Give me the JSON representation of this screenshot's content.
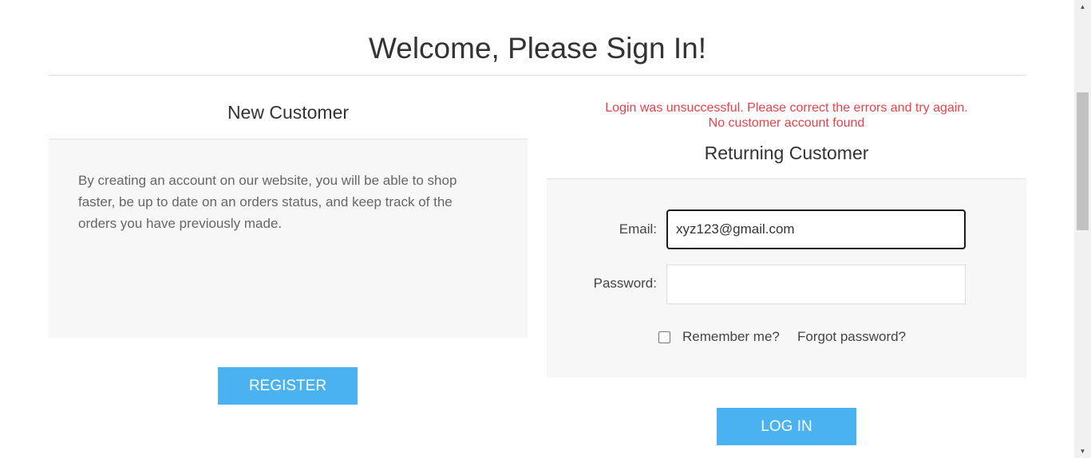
{
  "page": {
    "title": "Welcome, Please Sign In!"
  },
  "new_customer": {
    "heading": "New Customer",
    "description": "By creating an account on our website, you will be able to shop faster, be up to date on an orders status, and keep track of the orders you have previously made.",
    "register_label": "REGISTER"
  },
  "returning_customer": {
    "error_line1": "Login was unsuccessful. Please correct the errors and try again.",
    "error_line2": "No customer account found",
    "heading": "Returning Customer",
    "email_label": "Email:",
    "email_value": "xyz123@gmail.com",
    "password_label": "Password:",
    "password_value": "",
    "remember_label": "Remember me?",
    "remember_checked": false,
    "forgot_label": "Forgot password?",
    "login_label": "LOG IN"
  },
  "scrollbar": {
    "up_icon": "chevron-up-icon",
    "down_icon": "chevron-down-icon"
  },
  "colors": {
    "button": "#4ab2f1",
    "error": "#e4434b",
    "panel": "#f7f7f7"
  }
}
